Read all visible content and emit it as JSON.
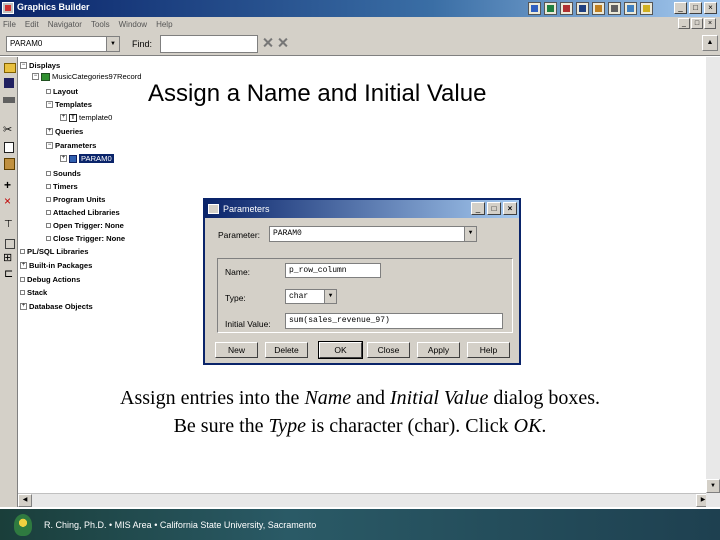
{
  "window": {
    "title": "Graphics Builder",
    "controls": [
      "_",
      "□",
      "×"
    ],
    "mdi_controls": [
      "_",
      "□",
      "×"
    ]
  },
  "menu": [
    "File",
    "Edit",
    "Navigator",
    "Tools",
    "Window",
    "Help"
  ],
  "toolbar": {
    "object_combo": "PARAM0",
    "find_label": "Find:",
    "find_value": ""
  },
  "tree": {
    "items": [
      {
        "label": "Displays",
        "expander": "−"
      },
      {
        "label": "MusicCategories97Record",
        "expander": "−"
      },
      {
        "label": "Layout",
        "expander": ""
      },
      {
        "label": "Templates",
        "expander": "−"
      },
      {
        "label": "template0",
        "expander": "+"
      },
      {
        "label": "Queries",
        "expander": "+"
      },
      {
        "label": "Parameters",
        "expander": "−"
      },
      {
        "label": "PARAM0",
        "expander": "+"
      },
      {
        "label": "Sounds",
        "expander": ""
      },
      {
        "label": "Timers",
        "expander": ""
      },
      {
        "label": "Program Units",
        "expander": ""
      },
      {
        "label": "Attached Libraries",
        "expander": ""
      },
      {
        "label": "Open Trigger: None",
        "expander": ""
      },
      {
        "label": "Close Trigger: None",
        "expander": ""
      },
      {
        "label": "PL/SQL Libraries",
        "expander": ""
      },
      {
        "label": "Built-in Packages",
        "expander": "+"
      },
      {
        "label": "Debug Actions",
        "expander": ""
      },
      {
        "label": "Stack",
        "expander": ""
      },
      {
        "label": "Database Objects",
        "expander": "+"
      }
    ]
  },
  "slide": {
    "title": "Assign a Name and Initial Value",
    "caption_line1_a": "Assign entries into the ",
    "caption_line1_b": "Name",
    "caption_line1_c": " and ",
    "caption_line1_d": "Initial Value",
    "caption_line1_e": " dialog boxes.",
    "caption_line2_a": "Be sure the ",
    "caption_line2_b": "Type",
    "caption_line2_c": " is character (char).  Click ",
    "caption_line2_d": "OK",
    "caption_line2_e": "."
  },
  "dialog": {
    "title": "Parameters",
    "parameter_label": "Parameter:",
    "parameter_value": "PARAM0",
    "name_label": "Name:",
    "name_value": "p_row_column",
    "type_label": "Type:",
    "type_value": "char",
    "initial_value_label": "Initial Value:",
    "initial_value_value": "sum(sales_revenue_97)",
    "buttons": [
      "New",
      "Delete",
      "OK",
      "Close",
      "Apply",
      "Help"
    ]
  },
  "footer": {
    "text": "R. Ching, Ph.D. • MIS Area  • California State University, Sacramento"
  }
}
